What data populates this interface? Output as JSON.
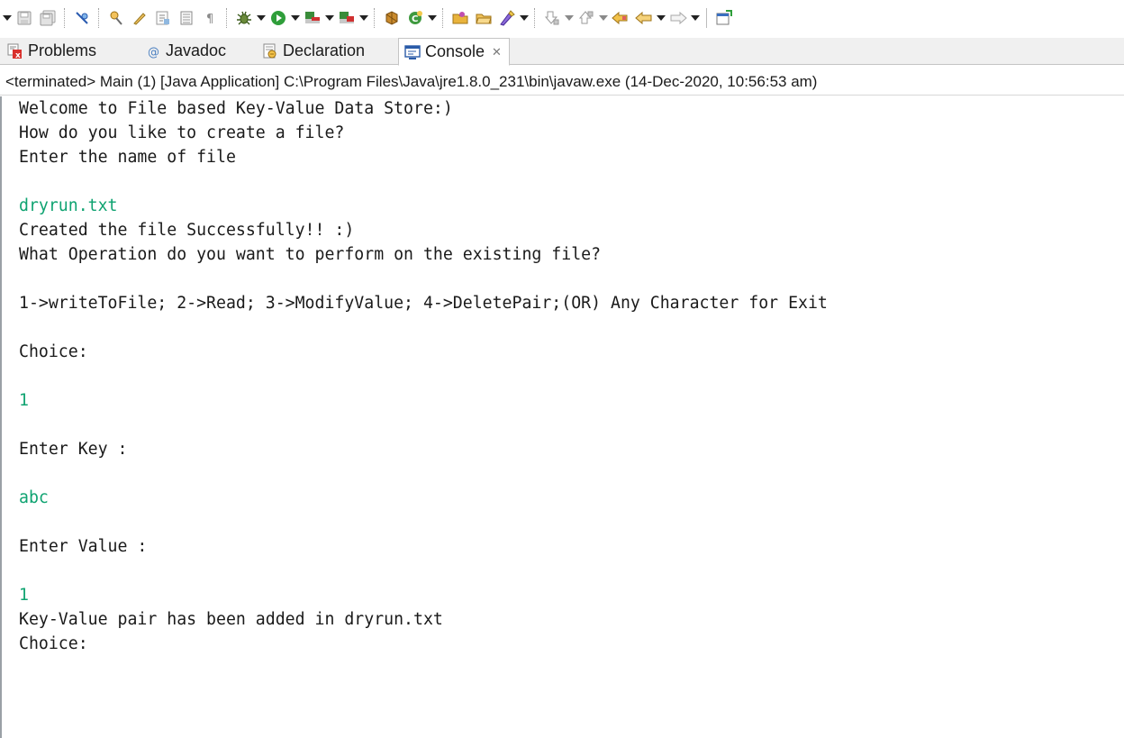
{
  "toolbar": {
    "icons": [
      "save-icon",
      "save-all-icon",
      "skip-breakpoints-icon",
      "open-type-icon",
      "edit-icon",
      "show-whitespace-icon",
      "toggle-block-icon",
      "pilcrow-icon",
      "debug-icon",
      "run-icon",
      "coverage-icon",
      "external-tools-icon",
      "new-java-class-icon",
      "new-package-icon",
      "open-folder-icon",
      "open-file-icon",
      "annotation-icon",
      "next-annotation-icon",
      "previous-annotation-icon",
      "back-icon",
      "forward-icon",
      "open-perspective-icon"
    ]
  },
  "tabs": [
    {
      "label": "Problems",
      "icon": "problems-icon",
      "active": false
    },
    {
      "label": "Javadoc",
      "icon": "javadoc-icon",
      "active": false
    },
    {
      "label": "Declaration",
      "icon": "declaration-icon",
      "active": false
    },
    {
      "label": "Console",
      "icon": "console-icon",
      "active": true,
      "close": "✕"
    }
  ],
  "console": {
    "status": "<terminated> Main (1) [Java Application] C:\\Program Files\\Java\\jre1.8.0_231\\bin\\javaw.exe (14-Dec-2020, 10:56:53 am)",
    "lines": [
      {
        "text": "Welcome to File based Key-Value Data Store:)",
        "kind": "output"
      },
      {
        "text": "How do you like to create a file?",
        "kind": "output"
      },
      {
        "text": "Enter the name of file",
        "kind": "output"
      },
      {
        "text": "dryrun.txt",
        "kind": "input"
      },
      {
        "text": "Created the file Successfully!! :)",
        "kind": "output"
      },
      {
        "text": "What Operation do you want to perform on the existing file?",
        "kind": "output"
      },
      {
        "text": "1->writeToFile; 2->Read; 3->ModifyValue; 4->DeletePair;(OR) Any Character for Exit",
        "kind": "output"
      },
      {
        "text": "Choice:",
        "kind": "output"
      },
      {
        "text": "1",
        "kind": "input"
      },
      {
        "text": "Enter Key :",
        "kind": "output"
      },
      {
        "text": "abc",
        "kind": "input"
      },
      {
        "text": "Enter Value :",
        "kind": "output"
      },
      {
        "text": "1",
        "kind": "input"
      },
      {
        "text": "Key-Value pair has been added in dryrun.txt",
        "kind": "output"
      },
      {
        "text": "Choice:",
        "kind": "output"
      }
    ]
  },
  "colors": {
    "input_text": "#0fa371",
    "output_text": "#1a1a1a"
  }
}
